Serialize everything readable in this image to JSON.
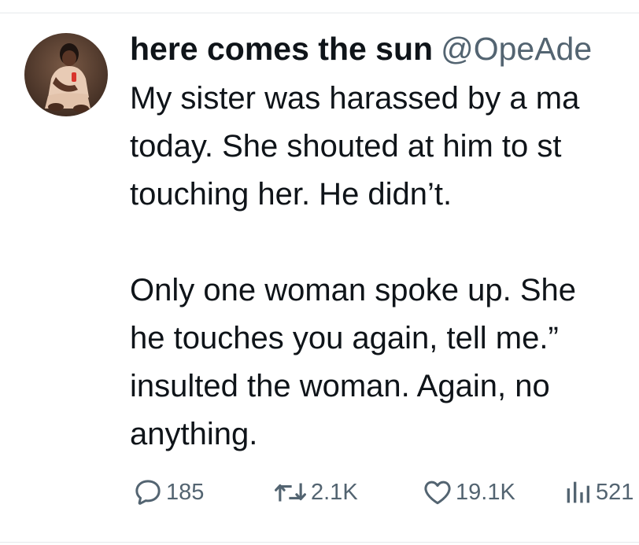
{
  "tweet": {
    "author": {
      "display_name": "here comes the sun",
      "handle": "@OpeAde"
    },
    "text_lines": [
      "My sister was harassed by a ma",
      "today. She shouted at him to st",
      "touching her. He didn’t.",
      "",
      "Only one woman spoke up. She",
      "he touches you again, tell me.” ",
      "insulted the woman. Again, no ",
      "anything."
    ],
    "metrics": {
      "replies": "185",
      "retweets": "2.1K",
      "likes": "19.1K",
      "views": "521"
    }
  },
  "icons": {
    "reply": "speech-bubble-icon",
    "retweet": "retweet-arrows-icon",
    "like": "heart-outline-icon",
    "views": "bar-chart-icon"
  },
  "colors": {
    "text_primary": "#0f1419",
    "text_secondary": "#536471",
    "divider": "#e6e9ec"
  }
}
